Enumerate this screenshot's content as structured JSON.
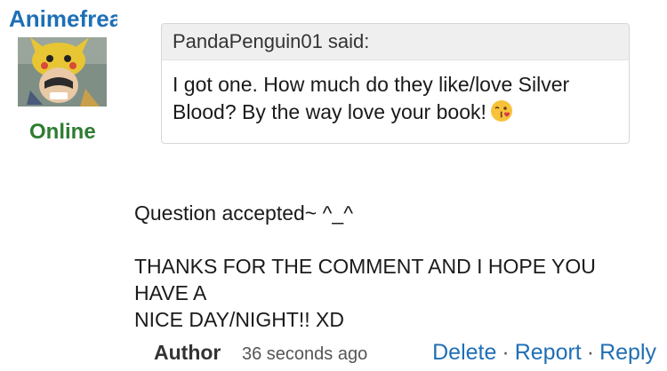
{
  "user": {
    "username": "Animefreak",
    "status": "Online",
    "avatar_icon": "avatar-image"
  },
  "quote": {
    "header": "PandaPenguin01 said:",
    "line1": "I got one. How much do they like/love Silver",
    "line2": "Blood? By the way love your book!",
    "emoji": "kissing-face-icon"
  },
  "message": {
    "line1": "Question accepted~ ^_^",
    "line2": "THANKS FOR THE COMMENT AND I HOPE YOU",
    "line3": "HAVE A",
    "line4": "NICE DAY/NIGHT!! XD"
  },
  "footer": {
    "author_label": "Author",
    "timestamp": "36 seconds ago",
    "delete_label": "Delete",
    "report_label": "Report",
    "reply_label": "Reply",
    "separator": "·"
  },
  "colors": {
    "link": "#1f6fb5",
    "online": "#2e7d32",
    "quote_header_bg": "#efefef"
  }
}
